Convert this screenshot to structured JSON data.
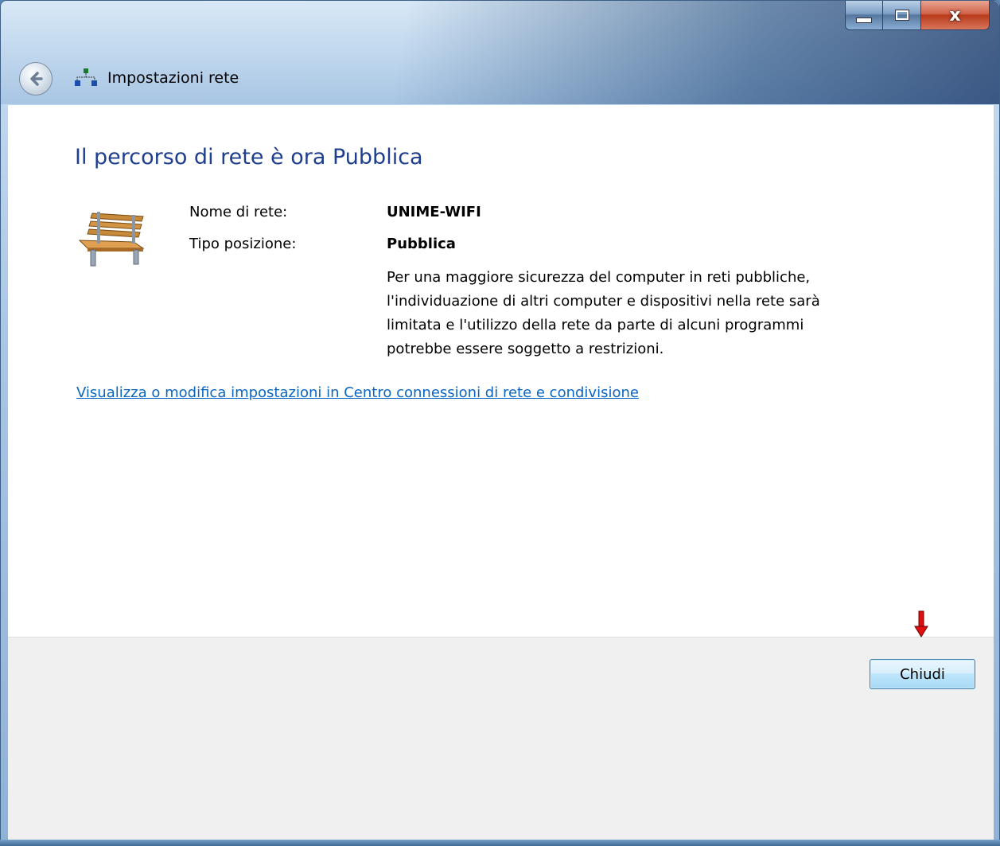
{
  "window": {
    "title": "Impostazioni rete",
    "caption_buttons": {
      "minimize": "minimize",
      "maximize": "maximize",
      "close": "x"
    }
  },
  "content": {
    "heading": "Il percorso di rete è ora Pubblica",
    "network_name_label": "Nome di rete:",
    "network_name_value": "UNIME-WIFI",
    "location_type_label": "Tipo posizione:",
    "location_type_value": "Pubblica",
    "description": "Per una maggiore sicurezza del computer in reti pubbliche, l'individuazione di altri computer e dispositivi nella rete sarà limitata e l'utilizzo della rete da parte di alcuni programmi potrebbe essere soggetto a restrizioni.",
    "link": "Visualizza o modifica impostazioni in Centro connessioni di rete e condivisione"
  },
  "footer": {
    "close_button": "Chiudi"
  },
  "icons": {
    "back": "back-arrow-icon",
    "network": "network-icon",
    "bench": "park-bench-icon",
    "annotation": "red-down-arrow-icon"
  },
  "colors": {
    "heading": "#1e3f8f",
    "link": "#0a66c2",
    "annotation_arrow": "#e01010"
  }
}
